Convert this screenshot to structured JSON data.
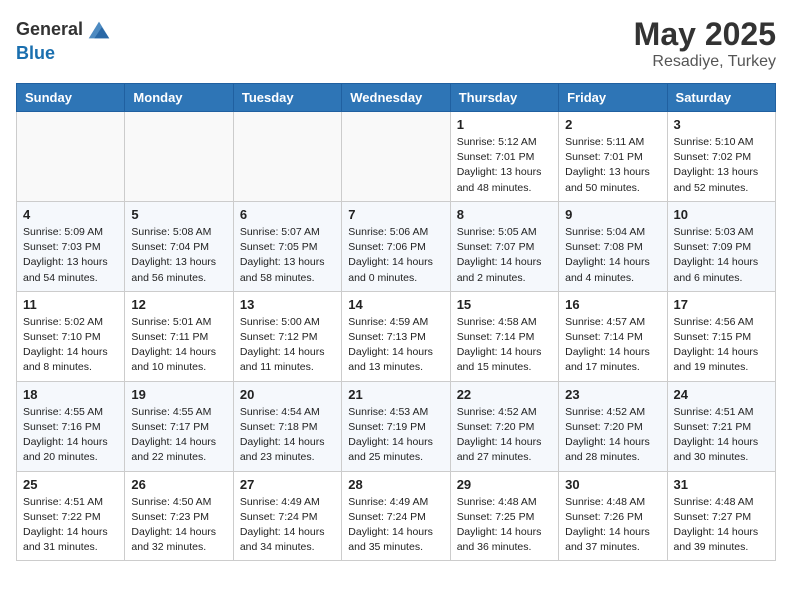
{
  "header": {
    "logo_general": "General",
    "logo_blue": "Blue",
    "month": "May 2025",
    "location": "Resadiye, Turkey"
  },
  "days_of_week": [
    "Sunday",
    "Monday",
    "Tuesday",
    "Wednesday",
    "Thursday",
    "Friday",
    "Saturday"
  ],
  "weeks": [
    [
      {
        "day": "",
        "info": ""
      },
      {
        "day": "",
        "info": ""
      },
      {
        "day": "",
        "info": ""
      },
      {
        "day": "",
        "info": ""
      },
      {
        "day": "1",
        "info": "Sunrise: 5:12 AM\nSunset: 7:01 PM\nDaylight: 13 hours\nand 48 minutes."
      },
      {
        "day": "2",
        "info": "Sunrise: 5:11 AM\nSunset: 7:01 PM\nDaylight: 13 hours\nand 50 minutes."
      },
      {
        "day": "3",
        "info": "Sunrise: 5:10 AM\nSunset: 7:02 PM\nDaylight: 13 hours\nand 52 minutes."
      }
    ],
    [
      {
        "day": "4",
        "info": "Sunrise: 5:09 AM\nSunset: 7:03 PM\nDaylight: 13 hours\nand 54 minutes."
      },
      {
        "day": "5",
        "info": "Sunrise: 5:08 AM\nSunset: 7:04 PM\nDaylight: 13 hours\nand 56 minutes."
      },
      {
        "day": "6",
        "info": "Sunrise: 5:07 AM\nSunset: 7:05 PM\nDaylight: 13 hours\nand 58 minutes."
      },
      {
        "day": "7",
        "info": "Sunrise: 5:06 AM\nSunset: 7:06 PM\nDaylight: 14 hours\nand 0 minutes."
      },
      {
        "day": "8",
        "info": "Sunrise: 5:05 AM\nSunset: 7:07 PM\nDaylight: 14 hours\nand 2 minutes."
      },
      {
        "day": "9",
        "info": "Sunrise: 5:04 AM\nSunset: 7:08 PM\nDaylight: 14 hours\nand 4 minutes."
      },
      {
        "day": "10",
        "info": "Sunrise: 5:03 AM\nSunset: 7:09 PM\nDaylight: 14 hours\nand 6 minutes."
      }
    ],
    [
      {
        "day": "11",
        "info": "Sunrise: 5:02 AM\nSunset: 7:10 PM\nDaylight: 14 hours\nand 8 minutes."
      },
      {
        "day": "12",
        "info": "Sunrise: 5:01 AM\nSunset: 7:11 PM\nDaylight: 14 hours\nand 10 minutes."
      },
      {
        "day": "13",
        "info": "Sunrise: 5:00 AM\nSunset: 7:12 PM\nDaylight: 14 hours\nand 11 minutes."
      },
      {
        "day": "14",
        "info": "Sunrise: 4:59 AM\nSunset: 7:13 PM\nDaylight: 14 hours\nand 13 minutes."
      },
      {
        "day": "15",
        "info": "Sunrise: 4:58 AM\nSunset: 7:14 PM\nDaylight: 14 hours\nand 15 minutes."
      },
      {
        "day": "16",
        "info": "Sunrise: 4:57 AM\nSunset: 7:14 PM\nDaylight: 14 hours\nand 17 minutes."
      },
      {
        "day": "17",
        "info": "Sunrise: 4:56 AM\nSunset: 7:15 PM\nDaylight: 14 hours\nand 19 minutes."
      }
    ],
    [
      {
        "day": "18",
        "info": "Sunrise: 4:55 AM\nSunset: 7:16 PM\nDaylight: 14 hours\nand 20 minutes."
      },
      {
        "day": "19",
        "info": "Sunrise: 4:55 AM\nSunset: 7:17 PM\nDaylight: 14 hours\nand 22 minutes."
      },
      {
        "day": "20",
        "info": "Sunrise: 4:54 AM\nSunset: 7:18 PM\nDaylight: 14 hours\nand 23 minutes."
      },
      {
        "day": "21",
        "info": "Sunrise: 4:53 AM\nSunset: 7:19 PM\nDaylight: 14 hours\nand 25 minutes."
      },
      {
        "day": "22",
        "info": "Sunrise: 4:52 AM\nSunset: 7:20 PM\nDaylight: 14 hours\nand 27 minutes."
      },
      {
        "day": "23",
        "info": "Sunrise: 4:52 AM\nSunset: 7:20 PM\nDaylight: 14 hours\nand 28 minutes."
      },
      {
        "day": "24",
        "info": "Sunrise: 4:51 AM\nSunset: 7:21 PM\nDaylight: 14 hours\nand 30 minutes."
      }
    ],
    [
      {
        "day": "25",
        "info": "Sunrise: 4:51 AM\nSunset: 7:22 PM\nDaylight: 14 hours\nand 31 minutes."
      },
      {
        "day": "26",
        "info": "Sunrise: 4:50 AM\nSunset: 7:23 PM\nDaylight: 14 hours\nand 32 minutes."
      },
      {
        "day": "27",
        "info": "Sunrise: 4:49 AM\nSunset: 7:24 PM\nDaylight: 14 hours\nand 34 minutes."
      },
      {
        "day": "28",
        "info": "Sunrise: 4:49 AM\nSunset: 7:24 PM\nDaylight: 14 hours\nand 35 minutes."
      },
      {
        "day": "29",
        "info": "Sunrise: 4:48 AM\nSunset: 7:25 PM\nDaylight: 14 hours\nand 36 minutes."
      },
      {
        "day": "30",
        "info": "Sunrise: 4:48 AM\nSunset: 7:26 PM\nDaylight: 14 hours\nand 37 minutes."
      },
      {
        "day": "31",
        "info": "Sunrise: 4:48 AM\nSunset: 7:27 PM\nDaylight: 14 hours\nand 39 minutes."
      }
    ]
  ]
}
